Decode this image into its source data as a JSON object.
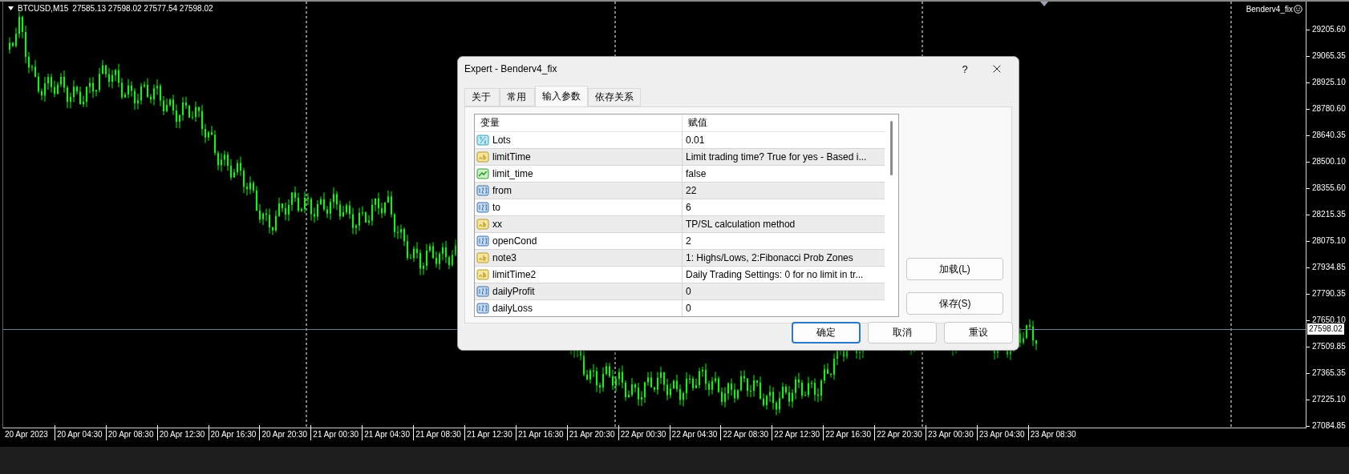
{
  "chart": {
    "symbol": "BTCUSD,M15",
    "ohlc": "27585.13 27598.02 27577.54 27598.02",
    "expert": "Benderv4_fix",
    "current_price": "27598.02",
    "price_levels": [
      "29205.60",
      "29065.35",
      "28925.10",
      "28780.60",
      "28640.35",
      "28500.10",
      "28355.60",
      "28215.35",
      "28075.10",
      "27934.85",
      "27790.35",
      "27650.10",
      "27509.85",
      "27365.35",
      "27225.10",
      "27084.85"
    ],
    "time_labels": [
      "20 Apr 2023",
      "20 Apr 04:30",
      "20 Apr 08:30",
      "20 Apr 12:30",
      "20 Apr 16:30",
      "20 Apr 20:30",
      "21 Apr 00:30",
      "21 Apr 04:30",
      "21 Apr 08:30",
      "21 Apr 12:30",
      "21 Apr 16:30",
      "21 Apr 20:30",
      "22 Apr 00:30",
      "22 Apr 04:30",
      "22 Apr 08:30",
      "22 Apr 12:30",
      "22 Apr 16:30",
      "22 Apr 20:30",
      "23 Apr 00:30",
      "23 Apr 04:30",
      "23 Apr 08:30"
    ]
  },
  "dialog": {
    "title": "Expert - Benderv4_fix",
    "help": "?",
    "tabs": [
      {
        "label": "关于",
        "selected": false
      },
      {
        "label": "常用",
        "selected": false
      },
      {
        "label": "输入参数",
        "selected": true
      },
      {
        "label": "依存关系",
        "selected": false
      }
    ],
    "columns": [
      "变量",
      "赋值"
    ],
    "rows": [
      {
        "kind": "double",
        "name": "Lots",
        "value": "0.01"
      },
      {
        "kind": "string",
        "name": "limitTime",
        "value": "Limit trading time? True for yes - Based i..."
      },
      {
        "kind": "bool",
        "name": "limit_time",
        "value": "false"
      },
      {
        "kind": "int",
        "name": "from",
        "value": "22"
      },
      {
        "kind": "int",
        "name": "to",
        "value": "6"
      },
      {
        "kind": "string",
        "name": "xx",
        "value": "TP/SL calculation method"
      },
      {
        "kind": "int",
        "name": "openCond",
        "value": "2"
      },
      {
        "kind": "string",
        "name": "note3",
        "value": "1: Highs/Lows, 2:Fibonacci Prob Zones"
      },
      {
        "kind": "string",
        "name": "limitTime2",
        "value": "Daily Trading Settings: 0 for no limit in tr..."
      },
      {
        "kind": "int",
        "name": "dailyProfit",
        "value": "0"
      },
      {
        "kind": "int",
        "name": "dailyLoss",
        "value": "0"
      }
    ],
    "side_buttons": [
      "加载(L)",
      "保存(S)"
    ],
    "buttons": [
      {
        "label": "确定",
        "default": true
      },
      {
        "label": "取消",
        "default": false
      },
      {
        "label": "重设",
        "default": false
      }
    ]
  }
}
